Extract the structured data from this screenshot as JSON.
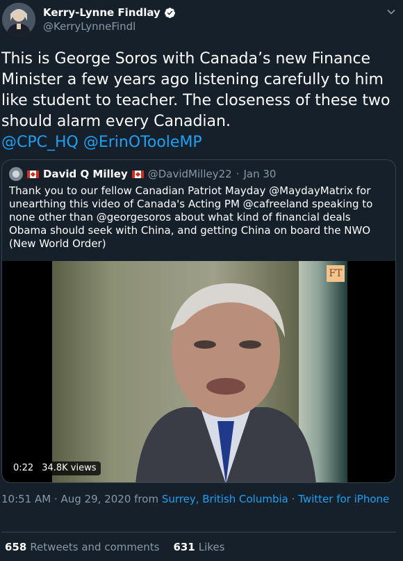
{
  "author": {
    "name": "Kerry-Lynne Findlay",
    "handle": "@KerryLynneFindl"
  },
  "tweet": {
    "text_before": "This is George Soros with Canada’s new Finance Minister a few years ago listening carefully to him like student to teacher.  The closeness of these two should alarm every Canadian.\n",
    "mention1": "@CPC_HQ",
    "mention2": "@ErinOTooleMP"
  },
  "quote": {
    "name": "David Q Milley",
    "handle": "@DavidMilley22",
    "date": "Jan 30",
    "text": "Thank you to our fellow Canadian Patriot Mayday @MaydayMatrix for unearthing this video of Canada's Acting PM @cafreeland speaking to none other than @georgesoros about what kind of financial deals Obama should seek with China, and getting China on board the NWO (New World Order)",
    "video": {
      "duration": "0:22",
      "views": "34.8K views",
      "logo": "FT"
    }
  },
  "meta": {
    "time": "10:51 AM",
    "date": "Aug 29, 2020",
    "from": "from",
    "location": "Surrey, British Columbia",
    "source": "Twitter for iPhone"
  },
  "stats": {
    "retweets_count": "658",
    "retweets_label": "Retweets and comments",
    "likes_count": "631",
    "likes_label": "Likes"
  },
  "colors": {
    "background": "#15202b",
    "accent": "#1da1f2",
    "muted": "#8899a6"
  }
}
